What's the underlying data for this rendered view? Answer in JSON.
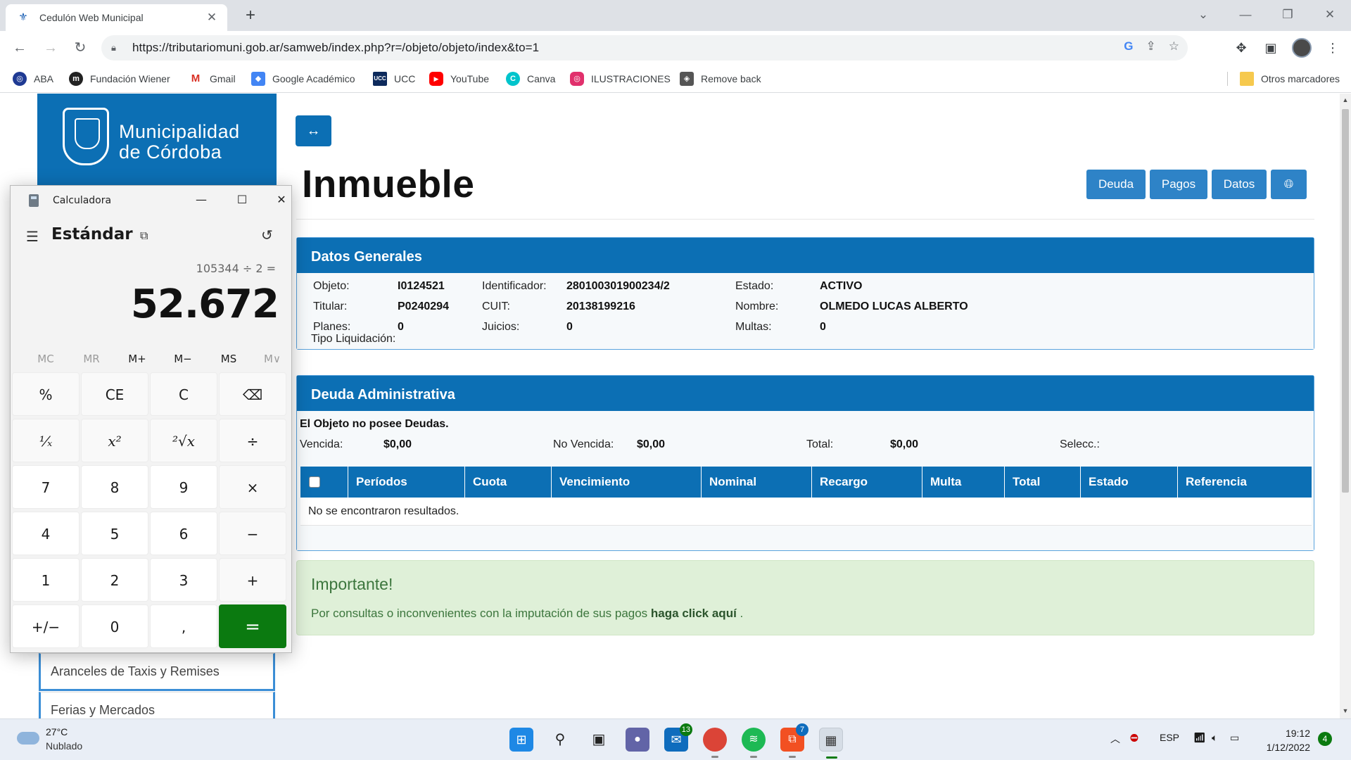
{
  "browser": {
    "tab_title": "Cedulón Web Municipal",
    "url": "https://tributariomuni.gob.ar/samweb/index.php?r=/objeto/objeto/index&to=1",
    "bookmarks": [
      {
        "label": "ABA",
        "icon": "globe-icon",
        "color": "#1f3a93"
      },
      {
        "label": "Fundación Wiener",
        "icon": "m-logo-icon",
        "color": "#222222"
      },
      {
        "label": "Gmail",
        "icon": "gmail-icon",
        "color": "#d93025"
      },
      {
        "label": "Google Académico",
        "icon": "scholar-icon",
        "color": "#4285f4"
      },
      {
        "label": "UCC",
        "icon": "ucc-icon",
        "color": "#0d2a5c"
      },
      {
        "label": "YouTube",
        "icon": "youtube-icon",
        "color": "#ff0000"
      },
      {
        "label": "Canva",
        "icon": "canva-icon",
        "color": "#00c4cc"
      },
      {
        "label": "ILUSTRACIONES",
        "icon": "instagram-icon",
        "color": "#e1306c"
      },
      {
        "label": "Remove back",
        "icon": "layers-icon",
        "color": "#555555"
      }
    ],
    "other_bookmarks": "Otros marcadores"
  },
  "sidebar": {
    "logo_line1": "Municipalidad",
    "logo_line2": "de Córdoba",
    "items": [
      "Aranceles de Taxis y Remises",
      "Ferias y Mercados"
    ]
  },
  "main": {
    "title": "Inmueble",
    "buttons": [
      "Deuda",
      "Pagos",
      "Datos"
    ],
    "datos_generales": {
      "heading": "Datos Generales",
      "fields": [
        {
          "label": "Objeto:",
          "value": "I0124521"
        },
        {
          "label": "Identificador:",
          "value": "280100301900234/2"
        },
        {
          "label": "Estado:",
          "value": "ACTIVO"
        },
        {
          "label": "Titular:",
          "value": "P0240294"
        },
        {
          "label": "CUIT:",
          "value": "20138199216"
        },
        {
          "label": "Nombre:",
          "value": "OLMEDO LUCAS ALBERTO"
        },
        {
          "label": "Planes:",
          "value": "0"
        },
        {
          "label": "Juicios:",
          "value": "0"
        },
        {
          "label": "Multas:",
          "value": "0"
        }
      ],
      "tipo_liquidacion": "Tipo Liquidación:"
    },
    "deuda": {
      "heading": "Deuda Administrativa",
      "no_debts": "El Objeto no posee Deudas.",
      "vencida_label": "Vencida:",
      "vencida_value": "$0,00",
      "no_vencida_label": "No Vencida:",
      "no_vencida_value": "$0,00",
      "total_label": "Total:",
      "total_value": "$0,00",
      "selecc_label": "Selecc.:",
      "columns": [
        "Períodos",
        "Cuota",
        "Vencimiento",
        "Nominal",
        "Recargo",
        "Multa",
        "Total",
        "Estado",
        "Referencia"
      ],
      "empty_message": "No se encontraron resultados."
    },
    "alert": {
      "title": "Importante!",
      "text": "Por consultas o inconvenientes con la imputación de sus pagos",
      "link": "haga click aquí",
      "suffix": "."
    }
  },
  "calculator": {
    "window_title": "Calculadora",
    "mode": "Estándar",
    "expression": "105344 ÷ 2 =",
    "display": "52.672",
    "memory": [
      "MC",
      "MR",
      "M+",
      "M−",
      "MS",
      "M∨"
    ],
    "memory_enabled": [
      false,
      false,
      true,
      true,
      true,
      false
    ],
    "keys": [
      [
        "%",
        "CE",
        "C",
        "⌫"
      ],
      [
        "¹⁄ₓ",
        "x²",
        "²√x",
        "÷"
      ],
      [
        "7",
        "8",
        "9",
        "×"
      ],
      [
        "4",
        "5",
        "6",
        "−"
      ],
      [
        "1",
        "2",
        "3",
        "+"
      ],
      [
        "+/−",
        "0",
        ",",
        "="
      ]
    ]
  },
  "taskbar": {
    "temp": "27°C",
    "condition": "Nublado",
    "mail_badge": "13",
    "office_badge": "7",
    "lang": "ESP",
    "time": "19:12",
    "date": "1/12/2022",
    "notifications": "4"
  }
}
